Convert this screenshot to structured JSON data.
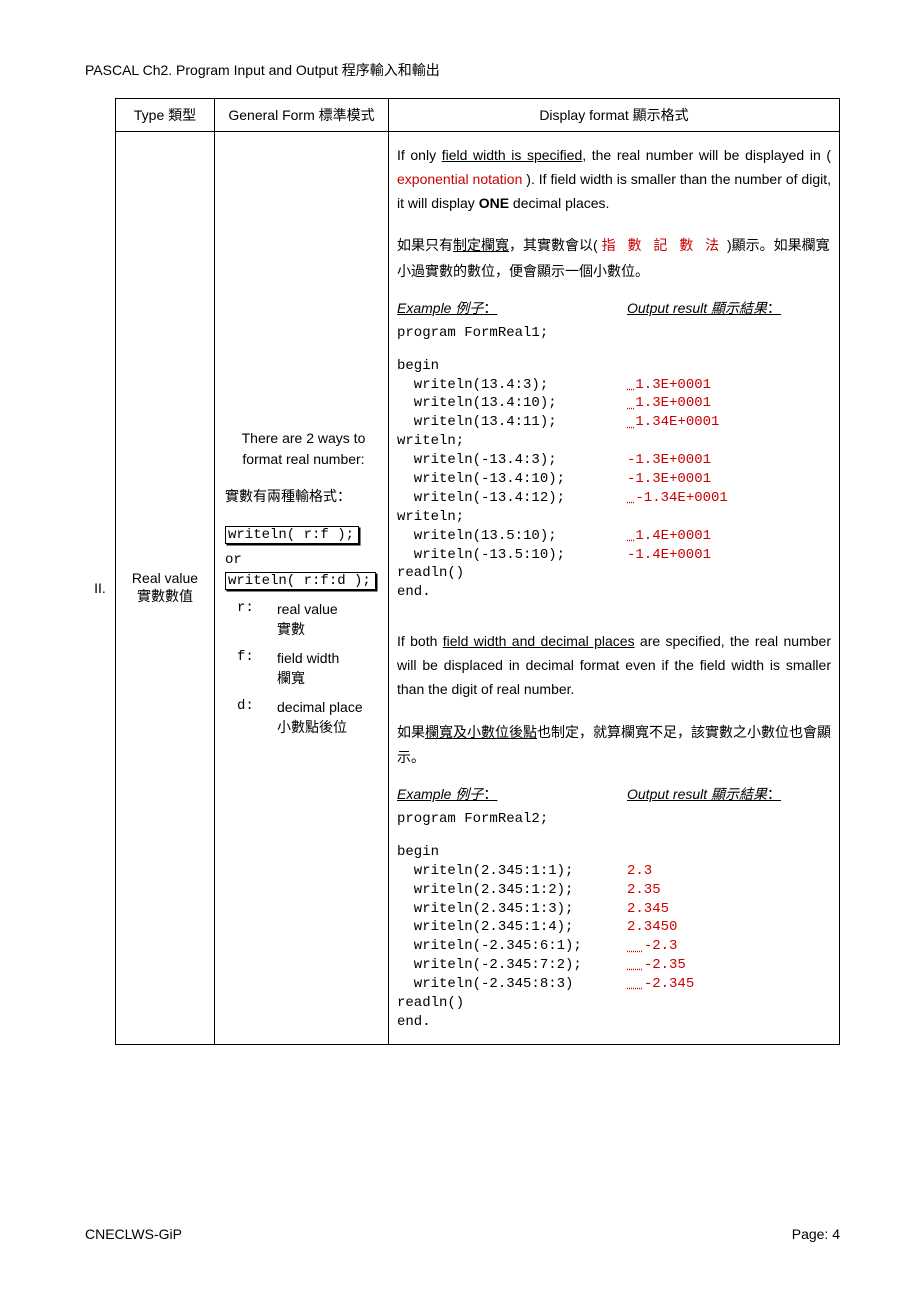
{
  "header": "PASCAL Ch2. Program Input and Output  程序輸入和輸出",
  "footer_left": "CNECLWS-GiP",
  "footer_right": "Page: 4",
  "th0": "",
  "th1": "Type  類型",
  "th2": "General Form  標準模式",
  "th3": "Display format  顯示格式",
  "rownum": "II.",
  "typecell_l1": "Real value",
  "typecell_l2": "實數數值",
  "gen_intro1": "There are 2 ways to",
  "gen_intro2": "format real number:",
  "gen_intro3": "實數有兩種輸格式：",
  "code1": "writeln( r:f );",
  "or": "or",
  "code2": "writeln( r:f:d );",
  "legend": {
    "r_k": "r:",
    "r_v": "real value\n實數",
    "f_k": "f:",
    "f_v": "field width\n欄寬",
    "d_k": "d:",
    "d_v": "decimal place\n小數點後位"
  },
  "p1_a": "If only ",
  "p1_u": "field width is specified",
  "p1_b": ", the real number will be displayed in ( ",
  "p1_red": "exponential notation",
  "p1_c": " ).   If field width is smaller than the number of digit, it will display ",
  "p1_bold": "ONE",
  "p1_d": " decimal places.",
  "p2_a": "如果只有",
  "p2_u": "制定欄寬",
  "p2_b": "，其實數會以( ",
  "p2_red": "指 數 記 數 法",
  "p2_c": " )顯示。如果欄寬小過實數的數位，便會顯示一個小數位。",
  "ex_label": "Example 例子",
  "out_label": "Output result  顯示結果",
  "colon": "：",
  "prog1_name": "program FormReal1;",
  "prog2_name": "program FormReal2;",
  "begin": "begin",
  "end": "end.",
  "readln": "  readln()",
  "writeln_blank": "  writeln;",
  "ex1": [
    {
      "l": "  writeln(13.4:3);",
      "r": " 1.3E+0001",
      "lead": true
    },
    {
      "l": "  writeln(13.4:10);",
      "r": " 1.3E+0001",
      "lead": true
    },
    {
      "l": "  writeln(13.4:11);",
      "r": " 1.34E+0001",
      "lead": true
    }
  ],
  "ex1b": [
    {
      "l": "  writeln(-13.4:3);",
      "r": "-1.3E+0001",
      "lead": false
    },
    {
      "l": "  writeln(-13.4:10);",
      "r": "-1.3E+0001",
      "lead": false
    },
    {
      "l": "  writeln(-13.4:12);",
      "r": " -1.34E+0001",
      "lead": true
    }
  ],
  "ex1c": [
    {
      "l": "  writeln(13.5:10);",
      "r": " 1.4E+0001",
      "lead": true
    },
    {
      "l": "  writeln(-13.5:10);",
      "r": "-1.4E+0001",
      "lead": false
    }
  ],
  "p3_a": "If both ",
  "p3_u": "field width and decimal places",
  "p3_b": " are specified, the real number will be displaced in decimal format even if the field width is smaller than the digit of real number.",
  "p4_a": "如果",
  "p4_u": "欄寬及小數位後點",
  "p4_b": "也制定，就算欄寬不足，該實數之小數位也會顯示。",
  "ex2": [
    {
      "l": "  writeln(2.345:1:1);",
      "r": "2.3",
      "lead": ""
    },
    {
      "l": "  writeln(2.345:1:2);",
      "r": "2.35",
      "lead": ""
    },
    {
      "l": "  writeln(2.345:1:3);",
      "r": "2.345",
      "lead": ""
    },
    {
      "l": "  writeln(2.345:1:4);",
      "r": "2.3450",
      "lead": ""
    },
    {
      "l": "  writeln(-2.345:6:1);",
      "r": "-2.3",
      "lead": "  "
    },
    {
      "l": "  writeln(-2.345:7:2);",
      "r": "-2.35",
      "lead": "  "
    },
    {
      "l": "  writeln(-2.345:8:3)",
      "r": "-2.345",
      "lead": "  "
    }
  ]
}
